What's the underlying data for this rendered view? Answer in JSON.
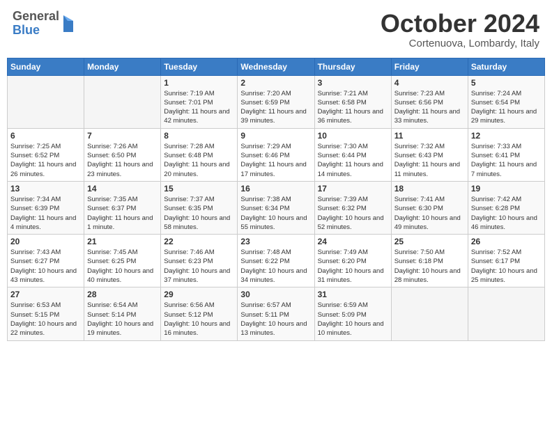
{
  "header": {
    "logo_general": "General",
    "logo_blue": "Blue",
    "month_title": "October 2024",
    "location": "Cortenuova, Lombardy, Italy"
  },
  "weekdays": [
    "Sunday",
    "Monday",
    "Tuesday",
    "Wednesday",
    "Thursday",
    "Friday",
    "Saturday"
  ],
  "weeks": [
    [
      {
        "day": "",
        "info": ""
      },
      {
        "day": "",
        "info": ""
      },
      {
        "day": "1",
        "info": "Sunrise: 7:19 AM\nSunset: 7:01 PM\nDaylight: 11 hours and 42 minutes."
      },
      {
        "day": "2",
        "info": "Sunrise: 7:20 AM\nSunset: 6:59 PM\nDaylight: 11 hours and 39 minutes."
      },
      {
        "day": "3",
        "info": "Sunrise: 7:21 AM\nSunset: 6:58 PM\nDaylight: 11 hours and 36 minutes."
      },
      {
        "day": "4",
        "info": "Sunrise: 7:23 AM\nSunset: 6:56 PM\nDaylight: 11 hours and 33 minutes."
      },
      {
        "day": "5",
        "info": "Sunrise: 7:24 AM\nSunset: 6:54 PM\nDaylight: 11 hours and 29 minutes."
      }
    ],
    [
      {
        "day": "6",
        "info": "Sunrise: 7:25 AM\nSunset: 6:52 PM\nDaylight: 11 hours and 26 minutes."
      },
      {
        "day": "7",
        "info": "Sunrise: 7:26 AM\nSunset: 6:50 PM\nDaylight: 11 hours and 23 minutes."
      },
      {
        "day": "8",
        "info": "Sunrise: 7:28 AM\nSunset: 6:48 PM\nDaylight: 11 hours and 20 minutes."
      },
      {
        "day": "9",
        "info": "Sunrise: 7:29 AM\nSunset: 6:46 PM\nDaylight: 11 hours and 17 minutes."
      },
      {
        "day": "10",
        "info": "Sunrise: 7:30 AM\nSunset: 6:44 PM\nDaylight: 11 hours and 14 minutes."
      },
      {
        "day": "11",
        "info": "Sunrise: 7:32 AM\nSunset: 6:43 PM\nDaylight: 11 hours and 11 minutes."
      },
      {
        "day": "12",
        "info": "Sunrise: 7:33 AM\nSunset: 6:41 PM\nDaylight: 11 hours and 7 minutes."
      }
    ],
    [
      {
        "day": "13",
        "info": "Sunrise: 7:34 AM\nSunset: 6:39 PM\nDaylight: 11 hours and 4 minutes."
      },
      {
        "day": "14",
        "info": "Sunrise: 7:35 AM\nSunset: 6:37 PM\nDaylight: 11 hours and 1 minute."
      },
      {
        "day": "15",
        "info": "Sunrise: 7:37 AM\nSunset: 6:35 PM\nDaylight: 10 hours and 58 minutes."
      },
      {
        "day": "16",
        "info": "Sunrise: 7:38 AM\nSunset: 6:34 PM\nDaylight: 10 hours and 55 minutes."
      },
      {
        "day": "17",
        "info": "Sunrise: 7:39 AM\nSunset: 6:32 PM\nDaylight: 10 hours and 52 minutes."
      },
      {
        "day": "18",
        "info": "Sunrise: 7:41 AM\nSunset: 6:30 PM\nDaylight: 10 hours and 49 minutes."
      },
      {
        "day": "19",
        "info": "Sunrise: 7:42 AM\nSunset: 6:28 PM\nDaylight: 10 hours and 46 minutes."
      }
    ],
    [
      {
        "day": "20",
        "info": "Sunrise: 7:43 AM\nSunset: 6:27 PM\nDaylight: 10 hours and 43 minutes."
      },
      {
        "day": "21",
        "info": "Sunrise: 7:45 AM\nSunset: 6:25 PM\nDaylight: 10 hours and 40 minutes."
      },
      {
        "day": "22",
        "info": "Sunrise: 7:46 AM\nSunset: 6:23 PM\nDaylight: 10 hours and 37 minutes."
      },
      {
        "day": "23",
        "info": "Sunrise: 7:48 AM\nSunset: 6:22 PM\nDaylight: 10 hours and 34 minutes."
      },
      {
        "day": "24",
        "info": "Sunrise: 7:49 AM\nSunset: 6:20 PM\nDaylight: 10 hours and 31 minutes."
      },
      {
        "day": "25",
        "info": "Sunrise: 7:50 AM\nSunset: 6:18 PM\nDaylight: 10 hours and 28 minutes."
      },
      {
        "day": "26",
        "info": "Sunrise: 7:52 AM\nSunset: 6:17 PM\nDaylight: 10 hours and 25 minutes."
      }
    ],
    [
      {
        "day": "27",
        "info": "Sunrise: 6:53 AM\nSunset: 5:15 PM\nDaylight: 10 hours and 22 minutes."
      },
      {
        "day": "28",
        "info": "Sunrise: 6:54 AM\nSunset: 5:14 PM\nDaylight: 10 hours and 19 minutes."
      },
      {
        "day": "29",
        "info": "Sunrise: 6:56 AM\nSunset: 5:12 PM\nDaylight: 10 hours and 16 minutes."
      },
      {
        "day": "30",
        "info": "Sunrise: 6:57 AM\nSunset: 5:11 PM\nDaylight: 10 hours and 13 minutes."
      },
      {
        "day": "31",
        "info": "Sunrise: 6:59 AM\nSunset: 5:09 PM\nDaylight: 10 hours and 10 minutes."
      },
      {
        "day": "",
        "info": ""
      },
      {
        "day": "",
        "info": ""
      }
    ]
  ]
}
